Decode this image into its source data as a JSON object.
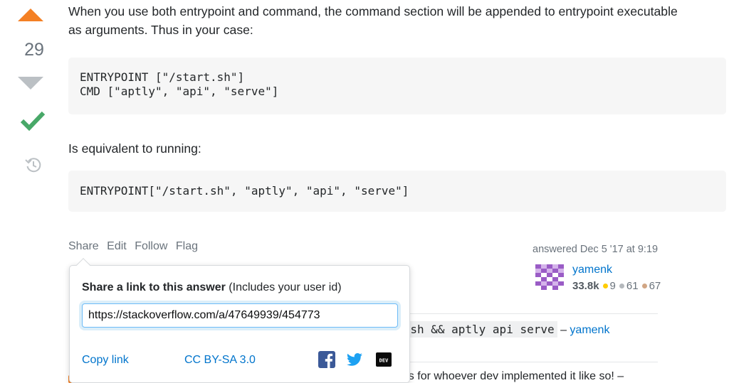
{
  "vote": {
    "count": "29"
  },
  "answer": {
    "paragraph1": "When you use both entrypoint and command, the command section will be appended to entrypoint executable as arguments. Thus in your case:",
    "code1": [
      "ENTRYPOINT [\"/start.sh\"]",
      "CMD [\"aptly\", \"api\", \"serve\"]"
    ],
    "paragraph2": "Is equivalent to running:",
    "code2": [
      "ENTRYPOINT[\"/start.sh\", \"aptly\", \"api\", \"serve\"]"
    ]
  },
  "menu": {
    "share": "Share",
    "edit": "Edit",
    "follow": "Follow",
    "flag": "Flag"
  },
  "signature": {
    "action": "answered Dec 5 '17 at 9:19",
    "user_name": "yamenk",
    "reputation": "33.8k",
    "gold": "9",
    "silver": "61",
    "bronze": "67"
  },
  "share_popup": {
    "title_bold": "Share a link to this answer",
    "title_note": " (Includes your user id)",
    "url": "https://stackoverflow.com/a/47649939/454773",
    "copy_link": "Copy link",
    "license": "CC BY-SA 3.0",
    "icons": [
      "facebook-icon",
      "twitter-icon",
      "dev-icon"
    ]
  },
  "comments": [
    {
      "code": "D ./start.sh && aptly api serve",
      "separator": " – ",
      "user": "yamenk"
    },
    {
      "text": "elings for whoever dev implemented it like so! –"
    }
  ],
  "colors": {
    "accent_orange": "#f48024",
    "accepted_green": "#48a868",
    "link_blue": "#0074cc",
    "muted": "#6a737c"
  }
}
